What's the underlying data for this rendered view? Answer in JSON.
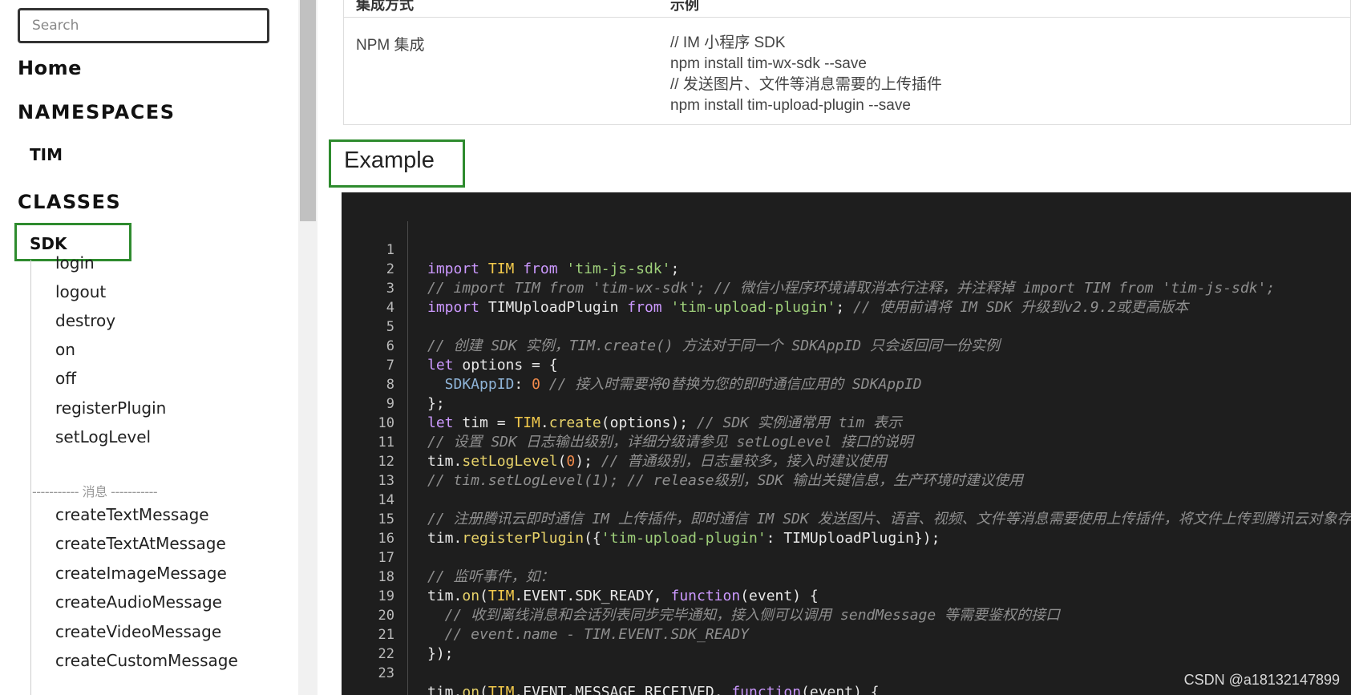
{
  "sidebar": {
    "search_placeholder": "Search",
    "home": "Home",
    "namespaces": "NAMESPACES",
    "tim": "TIM",
    "classes": "CLASSES",
    "sdk": "SDK",
    "methods_top": [
      "login",
      "logout",
      "destroy",
      "on",
      "off",
      "registerPlugin",
      "setLogLevel"
    ],
    "divider": "----------- 消息 -----------",
    "methods_message": [
      "createTextMessage",
      "createTextAtMessage",
      "createImageMessage",
      "createAudioMessage",
      "createVideoMessage",
      "createCustomMessage"
    ]
  },
  "table": {
    "header_col1": "集成方式",
    "header_col2": "示例",
    "row_label": "NPM 集成",
    "row_lines": [
      "// IM 小程序 SDK",
      "npm install tim-wx-sdk --save",
      "// 发送图片、文件等消息需要的上传插件",
      "npm install tim-upload-plugin --save"
    ]
  },
  "example_heading": "Example",
  "code": {
    "line_numbers": [
      "1",
      "2",
      "3",
      "4",
      "5",
      "6",
      "7",
      "8",
      "9",
      "10",
      "11",
      "12",
      "13",
      "14",
      "15",
      "16",
      "17",
      "18",
      "19",
      "20",
      "21",
      "22",
      "23"
    ],
    "l1": [
      "import",
      " TIM ",
      "from",
      " 'tim-js-sdk'",
      ";"
    ],
    "l2": "// import TIM from 'tim-wx-sdk'; // 微信小程序环境请取消本行注释，并注释掉 import TIM from 'tim-js-sdk';",
    "l3": [
      "import",
      " TIMUploadPlugin ",
      "from",
      " 'tim-upload-plugin'",
      "; ",
      "// 使用前请将 IM SDK 升级到v2.9.2或更高版本"
    ],
    "l5": "// 创建 SDK 实例，TIM.create() 方法对于同一个 SDKAppID 只会返回同一份实例",
    "l6": [
      "let",
      " options = {"
    ],
    "l7": [
      "  SDKAppID",
      ": ",
      "0",
      " ",
      "// 接入时需要将0替换为您的即时通信应用的 SDKAppID"
    ],
    "l8": "};",
    "l9": [
      "let",
      " tim = ",
      "TIM",
      ".",
      "create",
      "(options); ",
      "// SDK 实例通常用 tim 表示"
    ],
    "l10": "// 设置 SDK 日志输出级别，详细分级请参见 setLogLevel 接口的说明",
    "l11": [
      "tim.",
      "setLogLevel",
      "(",
      "0",
      "); ",
      "// 普通级别，日志量较多，接入时建议使用"
    ],
    "l12": "// tim.setLogLevel(1); // release级别，SDK 输出关键信息，生产环境时建议使用",
    "l14": "// 注册腾讯云即时通信 IM 上传插件，即时通信 IM SDK 发送图片、语音、视频、文件等消息需要使用上传插件，将文件上传到腾讯云对象存储",
    "l15": [
      "tim.",
      "registerPlugin",
      "({",
      "'tim-upload-plugin'",
      ": TIMUploadPlugin});"
    ],
    "l17": "// 监听事件，如：",
    "l18": [
      "tim.",
      "on",
      "(",
      "TIM",
      ".EVENT.SDK_READY, ",
      "function",
      "(event) {"
    ],
    "l19": "  // 收到离线消息和会话列表同步完毕通知，接入侧可以调用 sendMessage 等需要鉴权的接口",
    "l20": "  // event.name - TIM.EVENT.SDK_READY",
    "l21": "});",
    "l23": [
      "tim.",
      "on",
      "(",
      "TIM",
      ".EVENT.MESSAGE_RECEIVED, ",
      "function",
      "(event) {"
    ]
  },
  "watermark": "CSDN @a18132147899"
}
